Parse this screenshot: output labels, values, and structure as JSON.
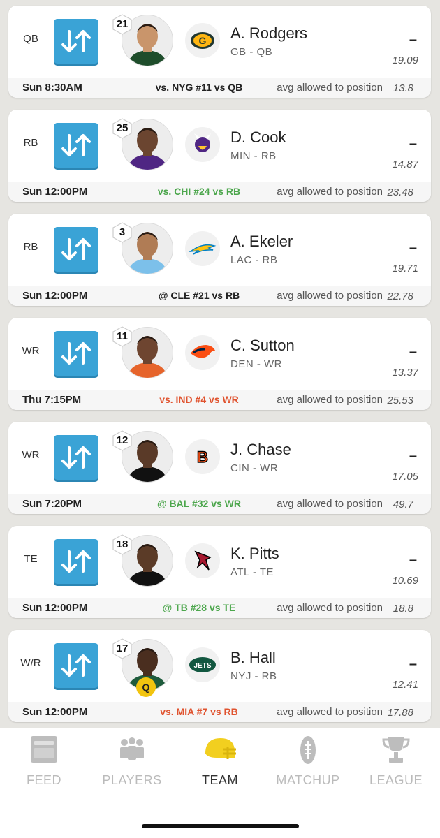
{
  "colors": {
    "accent": "#3aa3d6",
    "favorable": "#4ca64c",
    "unfavorable": "#e0532f",
    "neutral": "#222222",
    "active_tab": "#f2cf1f"
  },
  "roster": [
    {
      "slot": "QB",
      "rank": "21",
      "name": "A. Rodgers",
      "team_pos": "GB - QB",
      "team_logo": "packers-logo-icon",
      "status": null,
      "actual": "–",
      "projected": "19.09",
      "game_time": "Sun 8:30AM",
      "matchup": "vs. NYG #11 vs QB",
      "matchup_tone": "neutral",
      "avg_label": "avg allowed to position",
      "avg_allowed": "13.8"
    },
    {
      "slot": "RB",
      "rank": "25",
      "name": "D. Cook",
      "team_pos": "MIN - RB",
      "team_logo": "vikings-logo-icon",
      "status": null,
      "actual": "–",
      "projected": "14.87",
      "game_time": "Sun 12:00PM",
      "matchup": "vs. CHI #24 vs RB",
      "matchup_tone": "favorable",
      "avg_label": "avg allowed to position",
      "avg_allowed": "23.48"
    },
    {
      "slot": "RB",
      "rank": "3",
      "name": "A. Ekeler",
      "team_pos": "LAC - RB",
      "team_logo": "chargers-logo-icon",
      "status": null,
      "actual": "–",
      "projected": "19.71",
      "game_time": "Sun 12:00PM",
      "matchup": "@ CLE #21 vs RB",
      "matchup_tone": "neutral",
      "avg_label": "avg allowed to position",
      "avg_allowed": "22.78"
    },
    {
      "slot": "WR",
      "rank": "11",
      "name": "C. Sutton",
      "team_pos": "DEN - WR",
      "team_logo": "broncos-logo-icon",
      "status": null,
      "actual": "–",
      "projected": "13.37",
      "game_time": "Thu 7:15PM",
      "matchup": "vs. IND #4 vs WR",
      "matchup_tone": "unfavorable",
      "avg_label": "avg allowed to position",
      "avg_allowed": "25.53"
    },
    {
      "slot": "WR",
      "rank": "12",
      "name": "J. Chase",
      "team_pos": "CIN - WR",
      "team_logo": "bengals-logo-icon",
      "status": null,
      "actual": "–",
      "projected": "17.05",
      "game_time": "Sun 7:20PM",
      "matchup": "@ BAL #32 vs WR",
      "matchup_tone": "favorable",
      "avg_label": "avg allowed to position",
      "avg_allowed": "49.7"
    },
    {
      "slot": "TE",
      "rank": "18",
      "name": "K. Pitts",
      "team_pos": "ATL - TE",
      "team_logo": "falcons-logo-icon",
      "status": null,
      "actual": "–",
      "projected": "10.69",
      "game_time": "Sun 12:00PM",
      "matchup": "@ TB #28 vs TE",
      "matchup_tone": "favorable",
      "avg_label": "avg allowed to position",
      "avg_allowed": "18.8"
    },
    {
      "slot": "W/R",
      "rank": "17",
      "name": "B. Hall",
      "team_pos": "NYJ - RB",
      "team_logo": "jets-logo-icon",
      "status": "Q",
      "actual": "–",
      "projected": "12.41",
      "game_time": "Sun 12:00PM",
      "matchup": "vs. MIA #7 vs RB",
      "matchup_tone": "unfavorable",
      "avg_label": "avg allowed to position",
      "avg_allowed": "17.88"
    }
  ],
  "tabs": [
    {
      "label": "FEED",
      "icon": "feed-icon",
      "active": false
    },
    {
      "label": "PLAYERS",
      "icon": "players-icon",
      "active": false
    },
    {
      "label": "TEAM",
      "icon": "helmet-icon",
      "active": true
    },
    {
      "label": "MATCHUP",
      "icon": "football-icon",
      "active": false
    },
    {
      "label": "LEAGUE",
      "icon": "trophy-icon",
      "active": false
    }
  ]
}
